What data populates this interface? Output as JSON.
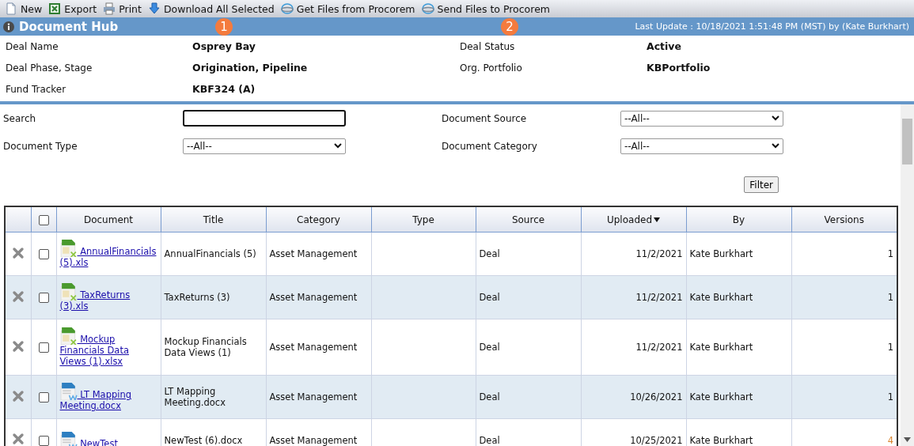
{
  "toolbar": [
    {
      "label": "New",
      "kind": "page"
    },
    {
      "label": "Export",
      "kind": "excel"
    },
    {
      "label": "Print",
      "kind": "printer"
    },
    {
      "label": "Download All Selected",
      "kind": "download"
    },
    {
      "label": "Get Files from Procorem",
      "kind": "globe"
    },
    {
      "label": "Send Files to Procorem",
      "kind": "globe"
    }
  ],
  "header": {
    "title": "Document Hub",
    "last_update": "Last Update : 10/18/2021 1:51:48 PM (MST) by (Kate Burkhart)"
  },
  "markers": [
    "1",
    "2"
  ],
  "details": [
    {
      "label": "Deal Name",
      "value": "Osprey Bay"
    },
    {
      "label": "Deal Status",
      "value": "Active"
    },
    {
      "label": "Deal Phase, Stage",
      "value": "Origination, Pipeline"
    },
    {
      "label": "Org. Portfolio",
      "value": "KBPortfolio"
    },
    {
      "label": "Fund Tracker",
      "value": "KBF324 (A)"
    }
  ],
  "filters": [
    {
      "label": "Search",
      "kind": "text"
    },
    {
      "label": "Document Source",
      "kind": "select",
      "value": "--All--"
    },
    {
      "label": "Document Type",
      "kind": "select",
      "value": "--All--"
    },
    {
      "label": "Document Category",
      "kind": "select",
      "value": "--All--"
    }
  ],
  "filter_button": "Filter",
  "table": {
    "select_all_checked": false,
    "columns": [
      {
        "label": "Document",
        "sorted": false
      },
      {
        "label": "Title",
        "sorted": false
      },
      {
        "label": "Category",
        "sorted": false
      },
      {
        "label": "Type",
        "sorted": false
      },
      {
        "label": "Source",
        "sorted": false
      },
      {
        "label": "Uploaded",
        "sorted": true
      },
      {
        "label": "By",
        "sorted": false
      },
      {
        "label": "Versions",
        "sorted": false
      }
    ],
    "rows": [
      {
        "checked": false,
        "kind": "xls",
        "document": " AnnualFinancials (5).xls",
        "title": "AnnualFinancials (5)",
        "category": "Asset Management",
        "source": "Deal",
        "uploaded": "11/2/2021",
        "by": "Kate Burkhart",
        "versions": "1",
        "versions_highlight": false
      },
      {
        "checked": false,
        "kind": "xls",
        "document": " TaxReturns (3).xls",
        "title": "TaxReturns (3)",
        "category": "Asset Management",
        "source": "Deal",
        "uploaded": "11/2/2021",
        "by": "Kate Burkhart",
        "versions": "1",
        "versions_highlight": false
      },
      {
        "checked": false,
        "kind": "xls",
        "document": " Mockup Financials Data Views (1).xlsx",
        "title": "Mockup Financials Data Views (1)",
        "category": "Asset Management",
        "source": "Deal",
        "uploaded": "11/2/2021",
        "by": "Kate Burkhart",
        "versions": "1",
        "versions_highlight": false
      },
      {
        "checked": false,
        "kind": "doc",
        "document": " LT Mapping Meeting.docx",
        "title": "LT Mapping Meeting.docx",
        "category": "Asset Management",
        "source": "Deal",
        "uploaded": "10/26/2021",
        "by": "Kate Burkhart",
        "versions": "1",
        "versions_highlight": false
      },
      {
        "checked": false,
        "kind": "doc",
        "document": " NewTest",
        "title": "NewTest (6).docx",
        "category": "Asset Management",
        "source": "Deal",
        "uploaded": "10/25/2021",
        "by": "Kate Burkhart",
        "versions": "4",
        "versions_highlight": true
      }
    ]
  }
}
